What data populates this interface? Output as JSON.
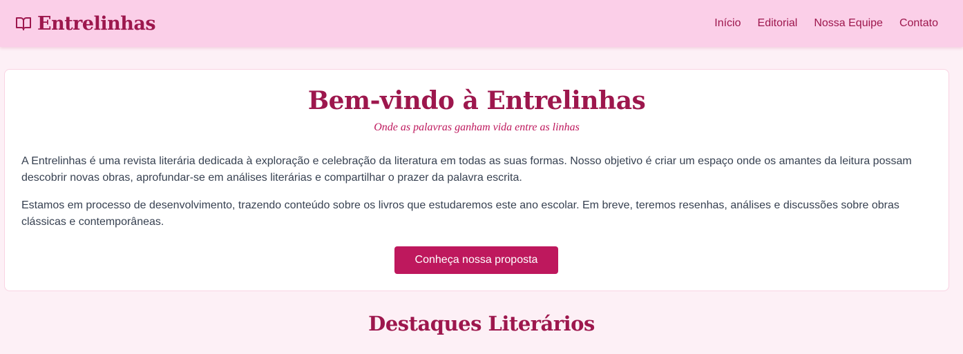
{
  "header": {
    "brand": "Entrelinhas",
    "brand_icon": "open-book-icon",
    "nav": [
      "Início",
      "Editorial",
      "Nossa Equipe",
      "Contato"
    ]
  },
  "hero": {
    "title": "Bem-vindo à Entrelinhas",
    "tagline": "Onde as palavras ganham vida entre as linhas",
    "paragraph1": "A Entrelinhas é uma revista literária dedicada à exploração e celebração da literatura em todas as suas formas. Nosso objetivo é criar um espaço onde os amantes da leitura possam descobrir novas obras, aprofundar-se em análises literárias e compartilhar o prazer da palavra escrita.",
    "paragraph2": "Estamos em processo de desenvolvimento, trazendo conteúdo sobre os livros que estudaremos este ano escolar. Em breve, teremos resenhas, análises e discussões sobre obras clássicas e contemporâneas.",
    "cta_label": "Conheça nossa proposta"
  },
  "highlights": {
    "title": "Destaques Literários"
  },
  "colors": {
    "navbar_bg": "#fbcfe8",
    "page_bg": "#fdf0f6",
    "brand": "#9d174d",
    "accent": "#be185d",
    "body_text": "#374151"
  }
}
